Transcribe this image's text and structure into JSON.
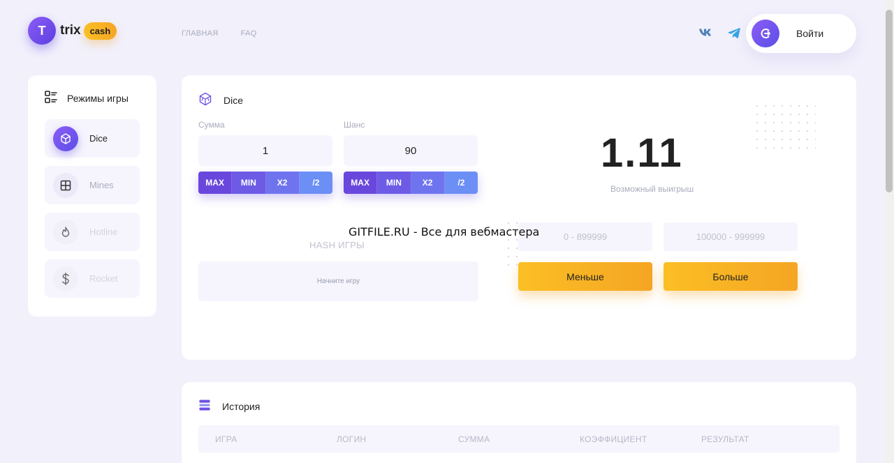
{
  "brand": {
    "letter": "T",
    "word": "trix",
    "pill": "cash"
  },
  "nav": [
    {
      "label": "ГЛАВНАЯ"
    },
    {
      "label": "FAQ"
    }
  ],
  "social": [
    {
      "icon": "vk-icon"
    },
    {
      "icon": "telegram-icon"
    }
  ],
  "login": {
    "label": "Войти",
    "icon": "login-icon"
  },
  "sidebar": {
    "title": "Режимы игры",
    "items": [
      {
        "label": "Dice",
        "icon": "dice-icon",
        "state": "active"
      },
      {
        "label": "Mines",
        "icon": "mines-grid-icon",
        "state": "normal"
      },
      {
        "label": "Hotline",
        "icon": "flame-icon",
        "state": "dim"
      },
      {
        "label": "Rocket",
        "icon": "dollar-icon",
        "state": "dim"
      }
    ]
  },
  "game": {
    "title": "Dice",
    "amount": {
      "label": "Сумма",
      "value": "1"
    },
    "chance": {
      "label": "Шанс",
      "value": "90"
    },
    "amount_buttons": [
      "MAX",
      "MIN",
      "X2",
      "/2"
    ],
    "chance_buttons": [
      "MAX",
      "MIN",
      "X2",
      "/2"
    ],
    "multiplier": "1.11",
    "multiplier_label": "Возможный выигрыш",
    "hash_title": "HASH ИГРЫ",
    "hash_value": "Начните игру",
    "range_low": "0 - 899999",
    "range_high": "100000 - 999999",
    "btn_less": "Меньше",
    "btn_more": "Больше",
    "watermark": "GITFILE.RU - Все для вебмастера"
  },
  "history": {
    "title": "История",
    "columns": [
      "ИГРА",
      "ЛОГИН",
      "СУММА",
      "КОЭФФИЦИЕНТ",
      "РЕЗУЛЬТАТ"
    ]
  },
  "colors": {
    "accent": "#6d4ee6",
    "accent_light": "#8b5cf6",
    "yellow": "#f5a524",
    "background": "#f1f0fb",
    "muted": "#a9abbd"
  }
}
